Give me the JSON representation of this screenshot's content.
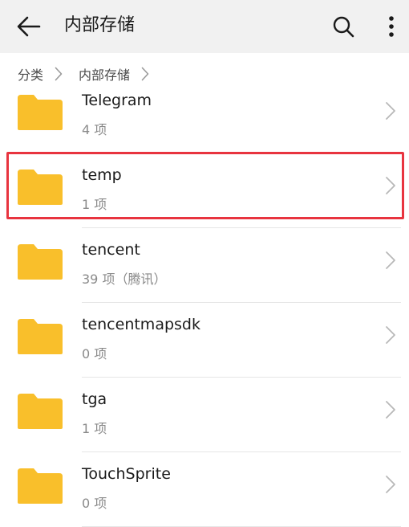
{
  "appbar": {
    "title": "内部存储",
    "back_icon": "arrow-left-icon",
    "search_icon": "search-icon",
    "more_icon": "more-vertical-icon"
  },
  "breadcrumb": [
    {
      "label": "分类"
    },
    {
      "label": "内部存储"
    }
  ],
  "folders": [
    {
      "name": "Telegram",
      "meta": "4 项"
    },
    {
      "name": "temp",
      "meta": "1 项",
      "highlighted": true
    },
    {
      "name": "tencent",
      "meta": "39 项（腾讯）"
    },
    {
      "name": "tencentmapsdk",
      "meta": "0 项"
    },
    {
      "name": "tga",
      "meta": "1 项"
    },
    {
      "name": "TouchSprite",
      "meta": "0 项"
    }
  ],
  "colors": {
    "folder": "#f9bf2b",
    "highlight_border": "#e8343f",
    "appbar_bg": "#f1f1f1"
  }
}
